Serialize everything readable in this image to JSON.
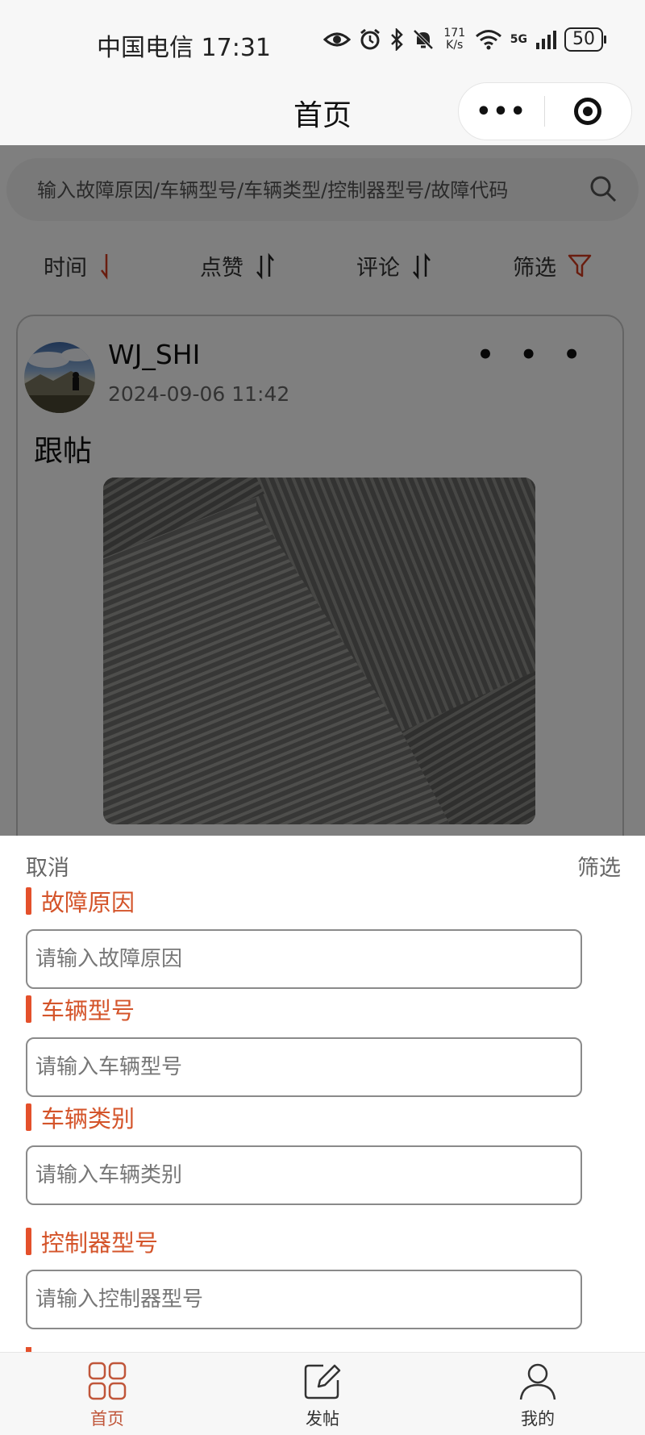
{
  "status_bar": {
    "carrier_time": "中国电信 17:31",
    "net_speed_value": "171",
    "net_speed_unit": "K/s",
    "signal_label": "5G",
    "battery": "50"
  },
  "nav": {
    "title": "首页",
    "more_label": "•••"
  },
  "search": {
    "placeholder": "输入故障原因/车辆型号/车辆类型/控制器型号/故障代码"
  },
  "sort_bar": {
    "items": [
      {
        "label": "时间",
        "icon": "arrow-down-icon"
      },
      {
        "label": "点赞",
        "icon": "sort-updown-icon"
      },
      {
        "label": "评论",
        "icon": "sort-updown-icon"
      },
      {
        "label": "筛选",
        "icon": "filter-icon"
      }
    ]
  },
  "post": {
    "username": "WJ_SHI",
    "time": "2024-09-06 11:42",
    "more_label": "• • •",
    "content": "跟帖"
  },
  "filter_sheet": {
    "cancel_label": "取消",
    "confirm_label": "筛选",
    "fields": [
      {
        "label": "故障原因",
        "placeholder": "请输入故障原因"
      },
      {
        "label": "车辆型号",
        "placeholder": "请输入车辆型号"
      },
      {
        "label": "车辆类别",
        "placeholder": "请输入车辆类别"
      },
      {
        "label": "控制器型号",
        "placeholder": "请输入控制器型号"
      }
    ]
  },
  "tab_bar": {
    "tabs": [
      {
        "label": "首页",
        "icon": "home-grid-icon",
        "active": true
      },
      {
        "label": "发帖",
        "icon": "edit-icon",
        "active": false
      },
      {
        "label": "我的",
        "icon": "user-icon",
        "active": false
      }
    ]
  },
  "colors": {
    "accent": "#e4502b",
    "accent_text": "#d4542a",
    "tab_active": "#c0563a"
  }
}
